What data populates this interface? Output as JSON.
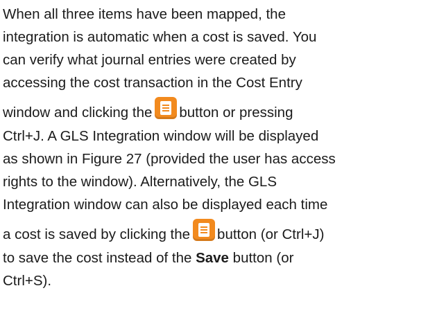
{
  "paragraph": {
    "l1": "When all three items have been mapped, the",
    "l2": "integration is automatic when a cost is saved. You",
    "l3": "can verify what journal entries were created by",
    "l4": "accessing the cost transaction in the Cost Entry",
    "l5a": "window and clicking the",
    "l5b": "button or pressing",
    "l6": "Ctrl+J. A GLS Integration window will be displayed",
    "l7": "as shown in Figure 27 (provided the user has access",
    "l8": "rights to the window). Alternatively, the GLS",
    "l9": "Integration window can also be displayed each time",
    "l10a": "a cost is saved by clicking the",
    "l10b": "button (or Ctrl+J)",
    "l11a": "to save the cost instead of the",
    "l11bold": "Save",
    "l11b": "button (or",
    "l12": "Ctrl+S)."
  },
  "icons": {
    "journal_button_icon": "journal-entries-icon",
    "color": "#f28a1e"
  }
}
